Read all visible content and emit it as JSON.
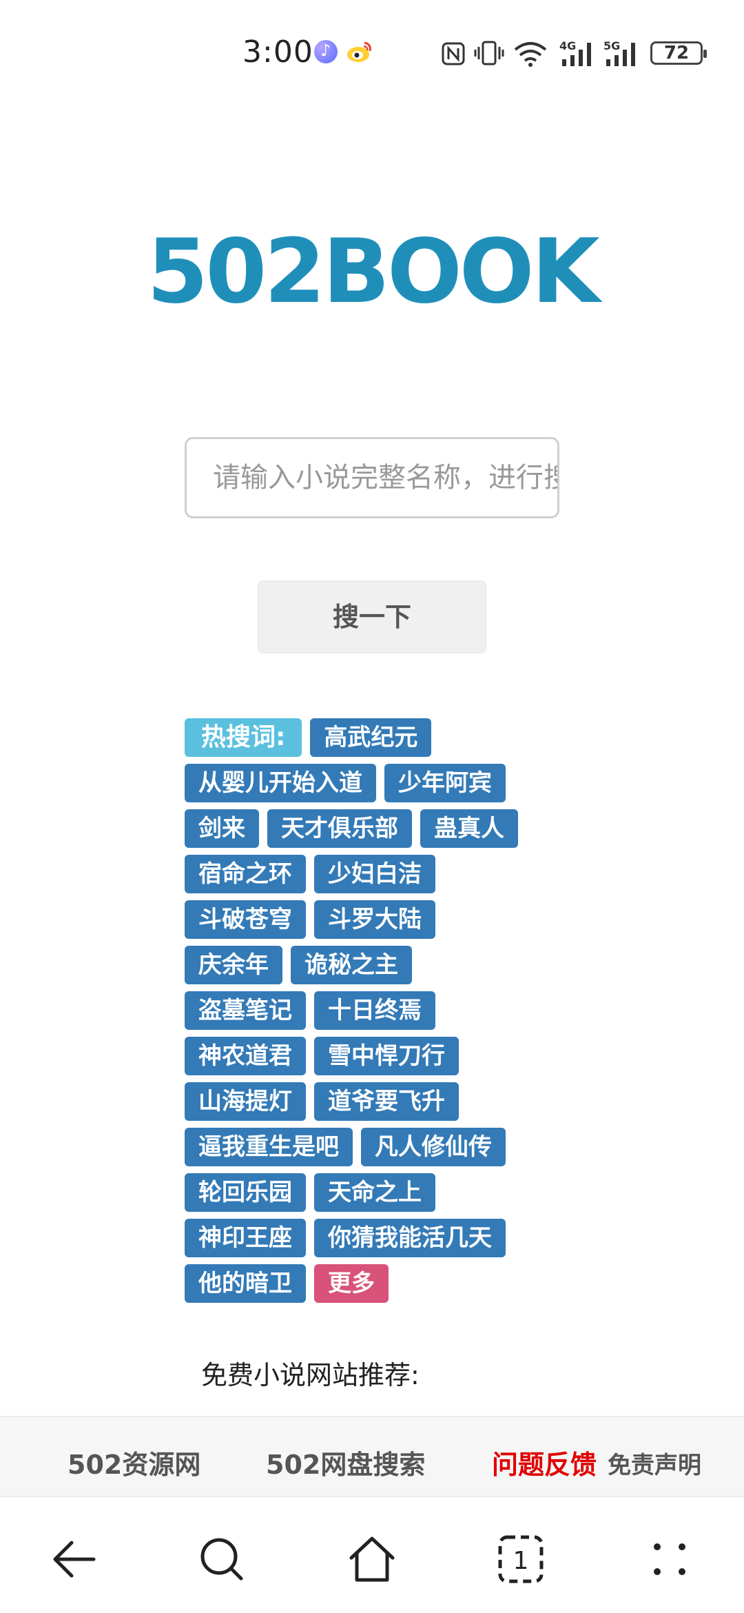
{
  "status_bar": {
    "time": "3:00",
    "battery": "72",
    "net_4g": "4G",
    "net_5g": "5G"
  },
  "logo": "502BOOK",
  "search": {
    "placeholder": "请输入小说完整名称，进行搜索",
    "button": "搜一下"
  },
  "hot": {
    "label": "热搜词:",
    "rows": [
      [
        "高武纪元"
      ],
      [
        "从婴儿开始入道",
        "少年阿宾"
      ],
      [
        "剑来",
        "天才俱乐部",
        "蛊真人"
      ],
      [
        "宿命之环",
        "少妇白洁"
      ],
      [
        "斗破苍穹",
        "斗罗大陆"
      ],
      [
        "庆余年",
        "诡秘之主"
      ],
      [
        "盗墓笔记",
        "十日终焉"
      ],
      [
        "神农道君",
        "雪中悍刀行"
      ],
      [
        "山海提灯",
        "道爷要飞升"
      ],
      [
        "逼我重生是吧",
        "凡人修仙传"
      ],
      [
        "轮回乐园",
        "天命之上"
      ],
      [
        "神印王座",
        "你猜我能活几天"
      ],
      [
        "他的暗卫"
      ]
    ],
    "more": "更多"
  },
  "recommend_label": "免费小说网站推荐:",
  "footer": {
    "link1": "502资源网",
    "link2": "502网盘搜索",
    "link3": "问题反馈",
    "link4": "免责声明"
  },
  "colors": {
    "logo": "#1f8fba",
    "tag": "#337ab7",
    "hot_label": "#5bc0de",
    "more": "#d9527a",
    "feedback": "#e00000"
  }
}
